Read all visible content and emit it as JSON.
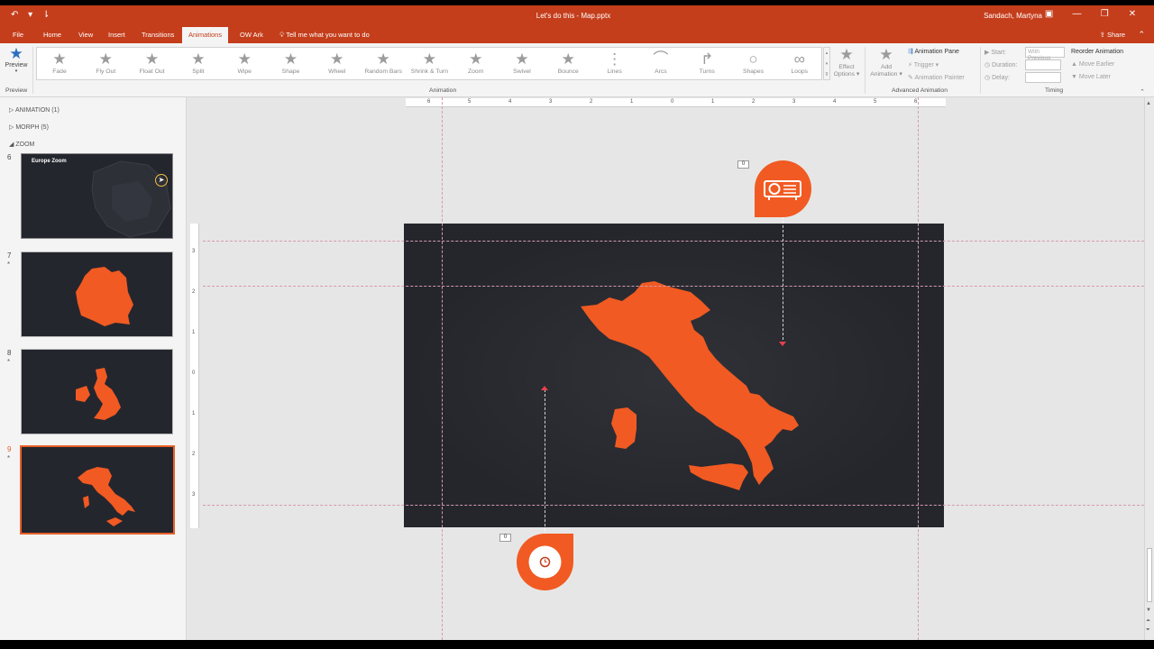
{
  "titlebar": {
    "undo": "↶",
    "redo": "▾",
    "customize": "⇂",
    "title": "Let's do this - Map.pptx",
    "user": "Sandach, Martyna",
    "ribbon_opts": "▣",
    "minimize": "—",
    "restore": "❐",
    "close": "✕"
  },
  "tabs": [
    "File",
    "Home",
    "View",
    "Insert",
    "Transitions",
    "Animations",
    "OW Ark"
  ],
  "tell_me": "Tell me what you want to do",
  "share": "Share",
  "ribbon": {
    "preview_label": "Preview",
    "preview_group": "Preview",
    "animations": [
      {
        "label": "Fade",
        "icon": "★"
      },
      {
        "label": "Fly Out",
        "icon": "★"
      },
      {
        "label": "Float Out",
        "icon": "★"
      },
      {
        "label": "Split",
        "icon": "★"
      },
      {
        "label": "Wipe",
        "icon": "★"
      },
      {
        "label": "Shape",
        "icon": "★"
      },
      {
        "label": "Wheel",
        "icon": "★"
      },
      {
        "label": "Random Bars",
        "icon": "★"
      },
      {
        "label": "Shrink & Turn",
        "icon": "★"
      },
      {
        "label": "Zoom",
        "icon": "★"
      },
      {
        "label": "Swivel",
        "icon": "★"
      },
      {
        "label": "Bounce",
        "icon": "★"
      },
      {
        "label": "Lines",
        "icon": "⋮"
      },
      {
        "label": "Arcs",
        "icon": "⌒"
      },
      {
        "label": "Turns",
        "icon": "↱"
      },
      {
        "label": "Shapes",
        "icon": "○"
      },
      {
        "label": "Loops",
        "icon": "∞"
      }
    ],
    "animation_group": "Animation",
    "effect_options_1": "Effect",
    "effect_options_2": "Options ▾",
    "add_animation_1": "Add",
    "add_animation_2": "Animation ▾",
    "animation_pane": "Animation Pane",
    "trigger": "Trigger ▾",
    "animation_painter": "Animation Painter",
    "advanced_group": "Advanced Animation",
    "start_label": "Start:",
    "start_value": "With Previous",
    "duration_label": "Duration:",
    "delay_label": "Delay:",
    "timing_group": "Timing",
    "reorder_title": "Reorder Animation",
    "move_earlier": "Move Earlier",
    "move_later": "Move Later"
  },
  "slides_panel": {
    "sections": [
      {
        "label": "ANIMATION (1)",
        "arrow": "▷"
      },
      {
        "label": "MORPH (5)",
        "arrow": "▷"
      },
      {
        "label": "ZOOM",
        "arrow": "◢"
      }
    ],
    "slides": [
      {
        "num": "6",
        "star": "",
        "title": "Europe Zoom"
      },
      {
        "num": "7",
        "star": "*",
        "title": ""
      },
      {
        "num": "8",
        "star": "*",
        "title": ""
      },
      {
        "num": "9",
        "star": "*",
        "title": ""
      }
    ]
  },
  "editor": {
    "hruler_ticks": [
      "6",
      "5",
      "4",
      "3",
      "2",
      "1",
      "0",
      "1",
      "2",
      "3",
      "4",
      "5",
      "6"
    ],
    "vruler_ticks": [
      "3",
      "2",
      "1",
      "0",
      "1",
      "2",
      "3"
    ],
    "tag_top": "0",
    "tag_bottom": "0"
  },
  "colors": {
    "accent": "#c43e1c",
    "map_orange": "#f15a22",
    "slide_bg": "#24262c"
  }
}
